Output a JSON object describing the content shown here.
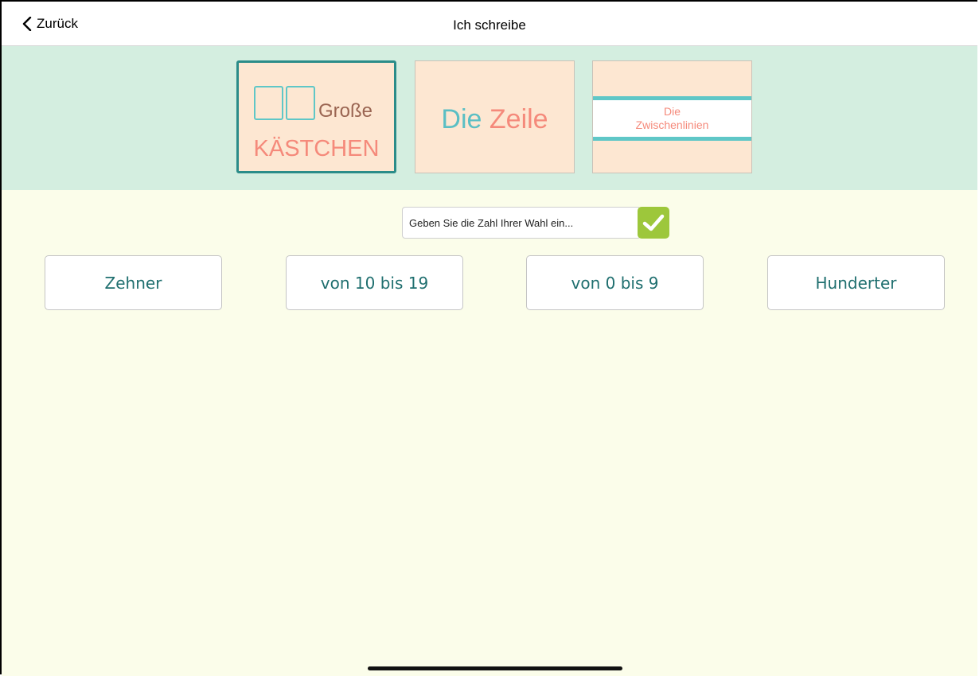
{
  "navbar": {
    "back_label": "Zurück",
    "title": "Ich schreibe"
  },
  "modes": [
    {
      "line1": "Große",
      "line2": "KÄSTCHEN",
      "selected": true
    },
    {
      "word1": "Die",
      "word2": "Zeile",
      "selected": false
    },
    {
      "line1": "Die",
      "line2": "Zwischenlinien",
      "selected": false
    }
  ],
  "entry": {
    "placeholder": "Geben Sie die Zahl Ihrer Wahl ein..."
  },
  "options": [
    {
      "label": "Zehner"
    },
    {
      "label": "von 10 bis 19"
    },
    {
      "label": "von 0 bis 9"
    },
    {
      "label": "Hunderter"
    }
  ],
  "colors": {
    "teal": "#2b8c89",
    "salmon": "#f58a7b",
    "confirm_green": "#9dc73b",
    "band_bg": "#d4eee0",
    "content_bg": "#fbfdea"
  }
}
